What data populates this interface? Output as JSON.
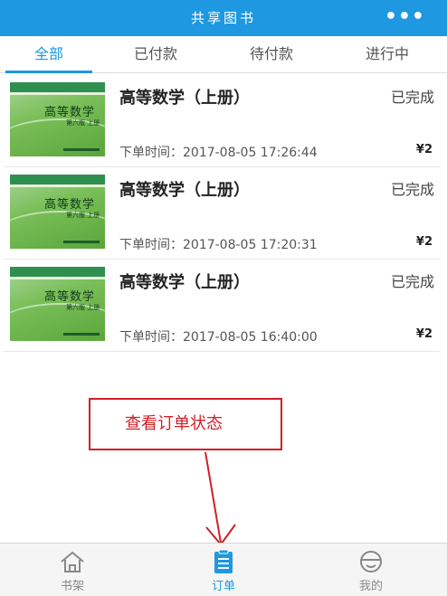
{
  "header": {
    "title": "共享图书",
    "more_label": "•••"
  },
  "tabs": [
    {
      "label": "全部",
      "active": true
    },
    {
      "label": "已付款",
      "active": false
    },
    {
      "label": "待付款",
      "active": false
    },
    {
      "label": "进行中",
      "active": false
    }
  ],
  "orders": [
    {
      "cover_title": "高等数学",
      "cover_sub": "第六版 上册",
      "title": "高等数学（上册）",
      "status": "已完成",
      "time": "下单时间：2017-08-05 17:26:44",
      "price": "¥2"
    },
    {
      "cover_title": "高等数学",
      "cover_sub": "第六版 上册",
      "title": "高等数学（上册）",
      "status": "已完成",
      "time": "下单时间：2017-08-05 17:20:31",
      "price": "¥2"
    },
    {
      "cover_title": "高等数学",
      "cover_sub": "第六版 上册",
      "title": "高等数学（上册）",
      "status": "已完成",
      "time": "下单时间：2017-08-05 16:40:00",
      "price": "¥2"
    }
  ],
  "annotation": {
    "text": "查看订单状态",
    "color": "#d21f26"
  },
  "bottom_nav": [
    {
      "label": "书架",
      "icon": "house-icon",
      "active": false
    },
    {
      "label": "订单",
      "icon": "clipboard-icon",
      "active": true
    },
    {
      "label": "我的",
      "icon": "face-icon",
      "active": false
    }
  ],
  "colors": {
    "accent": "#1e98e0",
    "annotation": "#d21f26"
  }
}
